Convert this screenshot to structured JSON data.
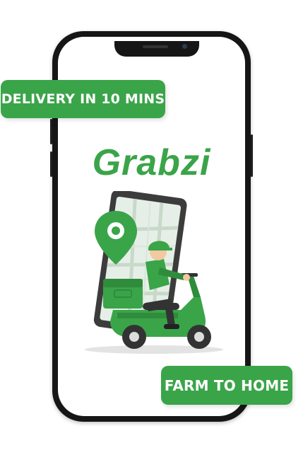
{
  "promo": {
    "delivery_label": "DELIVERY IN 10 MINS",
    "farm_label": "FARM TO HOME"
  },
  "brand": {
    "name": "Grabzi",
    "primary_color": "#3aa449"
  },
  "illustration": {
    "description_icon": "scooter-delivery-rider-icon"
  }
}
